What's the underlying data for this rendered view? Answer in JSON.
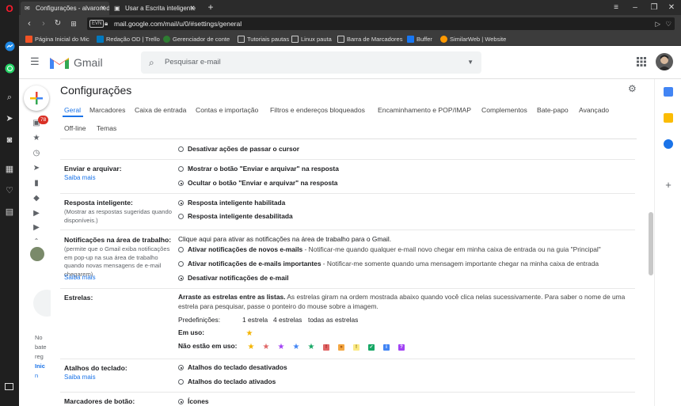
{
  "browser": {
    "tabs": [
      {
        "label": "Configurações - alvaroned",
        "active": true
      },
      {
        "label": "Usar a Escrita inteligente",
        "active": false
      }
    ],
    "new_tab": "+",
    "url": "mail.google.com/mail/u/0/#settings/general",
    "ev_badge": "EVN",
    "bookmarks": [
      {
        "label": "Página Inicial do Mic",
        "color": "#f35325"
      },
      {
        "label": "Redação OD | Trello",
        "color": "#0079bf"
      },
      {
        "label": "Gerenciador de conte",
        "color": "#2e7d32"
      },
      {
        "label": "Tutoriais pautas",
        "color": "#cccccc"
      },
      {
        "label": "Linux pauta",
        "color": "#cccccc"
      },
      {
        "label": "Barra de Marcadores",
        "color": "#cccccc"
      },
      {
        "label": "Buffer",
        "color": "#1877f2"
      },
      {
        "label": "SimilarWeb | Website",
        "color": "#ff9900"
      }
    ]
  },
  "gmail": {
    "brand": "Gmail",
    "search_placeholder": "Pesquisar e-mail",
    "inbox_badge": "78",
    "cut_texts": [
      "No",
      "bate",
      "reg",
      "Inic",
      "n"
    ],
    "settings_title": "Configurações",
    "tabs": [
      "Geral",
      "Marcadores",
      "Caixa de entrada",
      "Contas e importação",
      "Filtros e endereços bloqueados",
      "Encaminhamento e POP/IMAP",
      "Complementos",
      "Bate-papo",
      "Avançado",
      "Off-line",
      "Temas"
    ],
    "hover_option": "Desativar ações de passar o cursor",
    "send_archive": {
      "label": "Enviar e arquivar:",
      "learn_more": "Saiba mais",
      "opt1": "Mostrar o botão \"Enviar e arquivar\" na resposta",
      "opt2": "Ocultar o botão \"Enviar e arquivar\" na resposta"
    },
    "smart_reply": {
      "label": "Resposta inteligente:",
      "sub": "(Mostrar as respostas sugeridas quando disponíveis.)",
      "opt1": "Resposta inteligente habilitada",
      "opt2": "Resposta inteligente desabilitada"
    },
    "desktop_notif": {
      "label": "Notificações na área de trabalho:",
      "sub": "(permite que o Gmail exiba notificações em pop-up na sua área de trabalho quando novas mensagens de e-mail chegarem)",
      "learn_more": "Saiba mais",
      "link": "Clique aqui para ativar as notificações na área de trabalho para o Gmail.",
      "opt1_bold": "Ativar notificações de novos e-mails",
      "opt1_desc": " - Notificar-me quando qualquer e-mail novo chegar em minha caixa de entrada ou na guia \"Principal\"",
      "opt2_bold": "Ativar notificações de e-mails importantes",
      "opt2_desc": " - Notificar-me somente quando uma mensagem importante chegar na minha caixa de entrada",
      "opt3": "Desativar notificações de e-mail"
    },
    "stars": {
      "label": "Estrelas:",
      "desc_bold": "Arraste as estrelas entre as listas.",
      "desc_line1": " As estrelas giram na ordem mostrada abaixo quando você clica nelas sucessivamente. Para saber o nome de uma",
      "desc_line2": "estrela para pesquisar, passe o ponteiro do mouse sobre a imagem.",
      "presets_label": "Predefinições:",
      "preset1": "1 estrela",
      "preset2": "4 estrelas",
      "preset3": "todas as estrelas",
      "in_use": "Em uso:",
      "not_in_use": "Não estão em uso:",
      "not_in_use_stars": [
        "#f4b400",
        "#e06666",
        "#a142f4",
        "#4285f4",
        "#16a765"
      ],
      "not_in_use_marks": [
        {
          "glyph": "!",
          "bg": "#e06666",
          "fg": "#8b0000"
        },
        {
          "glyph": "»",
          "bg": "#f4a742",
          "fg": "#8b3a00"
        },
        {
          "glyph": "!",
          "bg": "#fbe983",
          "fg": "#7a6200"
        },
        {
          "glyph": "✓",
          "bg": "#16a765",
          "fg": "#ffffff"
        },
        {
          "glyph": "i",
          "bg": "#4285f4",
          "fg": "#ffffff"
        },
        {
          "glyph": "?",
          "bg": "#a142f4",
          "fg": "#ffffff"
        }
      ]
    },
    "shortcuts": {
      "label": "Atalhos do teclado:",
      "learn_more": "Saiba mais",
      "opt1": "Atalhos do teclado desativados",
      "opt2": "Atalhos do teclado ativados"
    },
    "button_labels": {
      "label": "Marcadores de botão:",
      "opt1": "Ícones"
    }
  }
}
